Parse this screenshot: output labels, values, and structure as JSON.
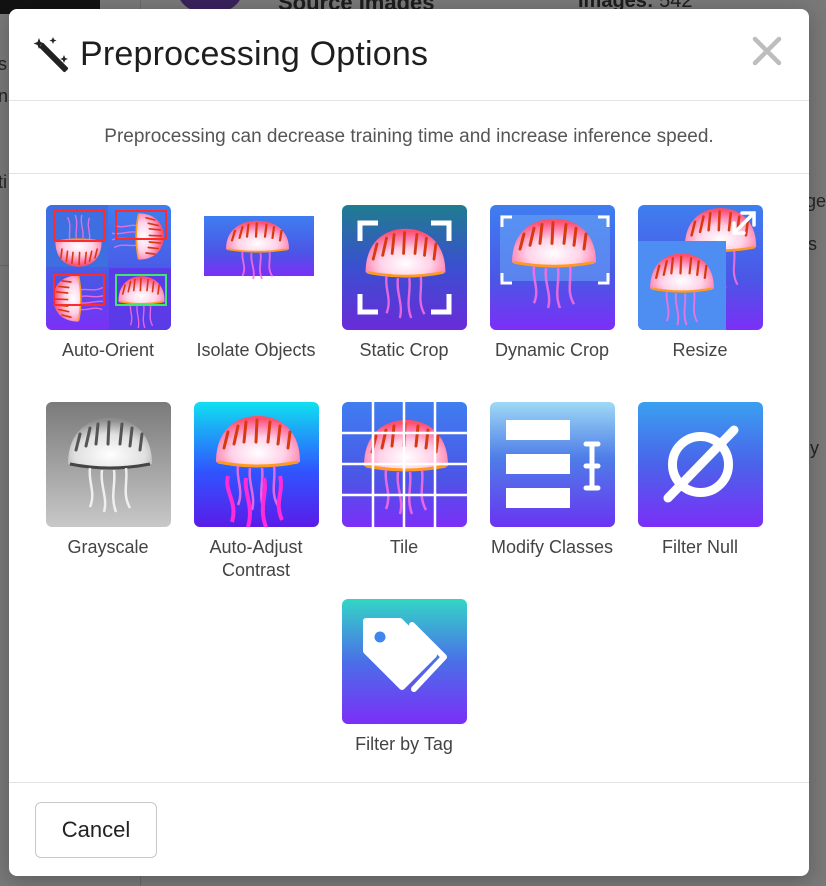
{
  "background": {
    "heading": "Source Images",
    "images_label": "Images:",
    "images_count": "542",
    "fragments": [
      "s",
      "n",
      "ti",
      "ge",
      "s",
      "y"
    ]
  },
  "modal": {
    "title": "Preprocessing Options",
    "title_icon": "magic-wand-icon",
    "close_icon": "close-icon",
    "subtitle": "Preprocessing can decrease training time and increase inference speed.",
    "options": [
      {
        "label": "Auto-Orient",
        "icon": "auto-orient-icon"
      },
      {
        "label": "Isolate Objects",
        "icon": "isolate-objects-icon"
      },
      {
        "label": "Static Crop",
        "icon": "static-crop-icon"
      },
      {
        "label": "Dynamic Crop",
        "icon": "dynamic-crop-icon"
      },
      {
        "label": "Resize",
        "icon": "resize-icon"
      },
      {
        "label": "Grayscale",
        "icon": "grayscale-icon"
      },
      {
        "label": "Auto-Adjust Contrast",
        "icon": "auto-adjust-contrast-icon"
      },
      {
        "label": "Tile",
        "icon": "tile-icon"
      },
      {
        "label": "Modify Classes",
        "icon": "modify-classes-icon"
      },
      {
        "label": "Filter Null",
        "icon": "filter-null-icon"
      },
      {
        "label": "Filter by Tag",
        "icon": "filter-by-tag-icon"
      }
    ],
    "cancel_label": "Cancel"
  },
  "colors": {
    "accent_purple": "#7b2ff7",
    "accent_blue": "#3f7ef0",
    "accent_teal": "#35d6c6"
  }
}
